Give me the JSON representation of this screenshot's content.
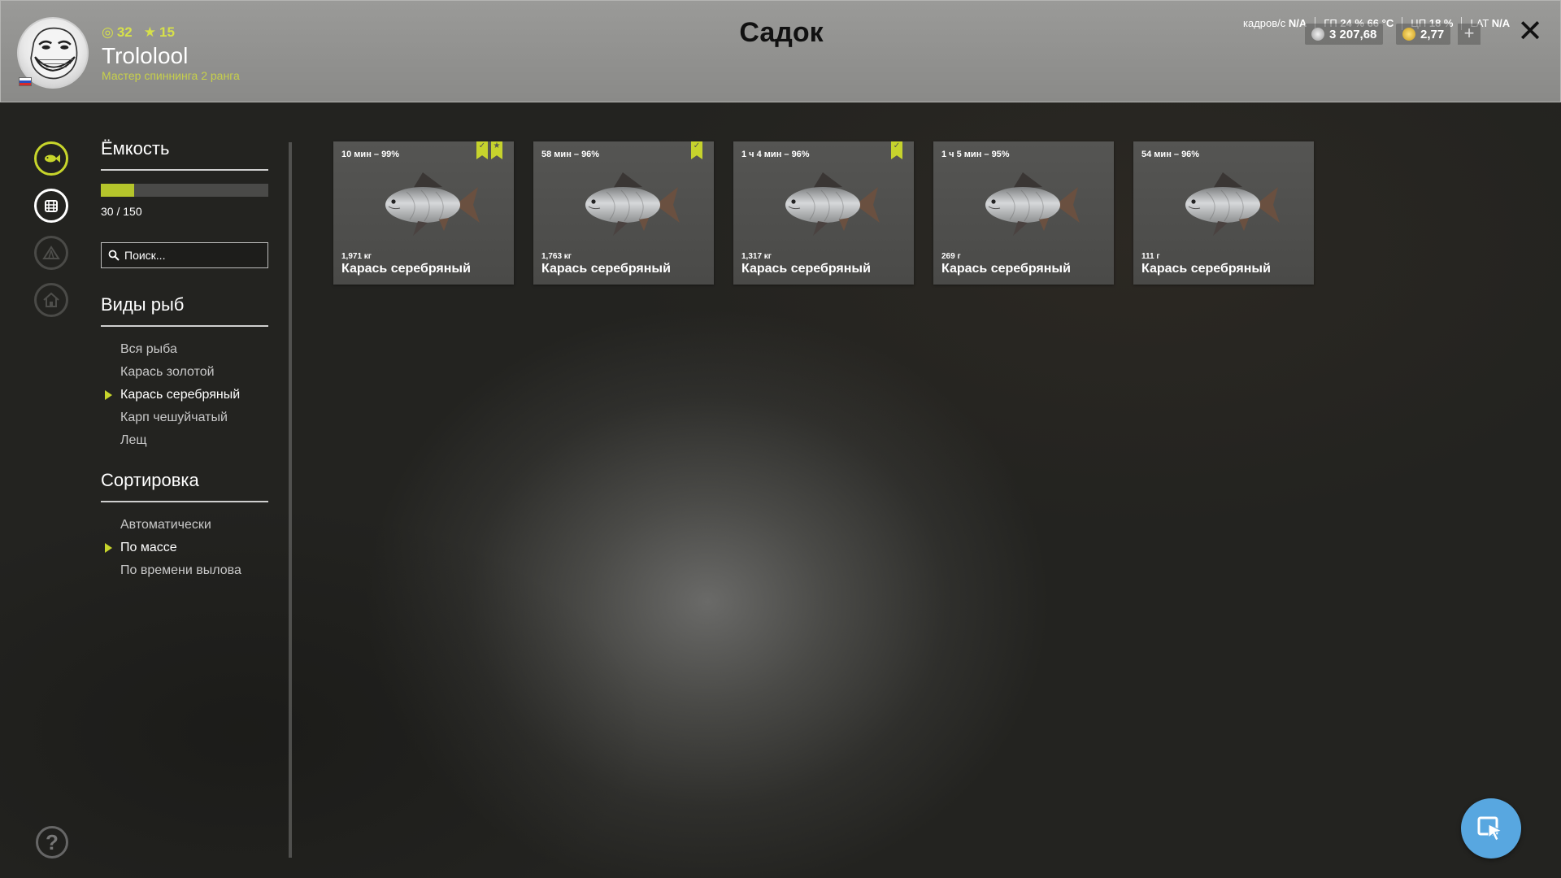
{
  "header": {
    "title": "Садок",
    "player": {
      "name": "Trololool",
      "rank": "Мастер спиннинга 2 ранга",
      "level": "32",
      "stars": "15"
    },
    "perf": {
      "fps_label": "кадров/с",
      "fps_value": "N/A",
      "gpu_label": "ГП",
      "gpu_value": "24 %",
      "temp_value": "66 °C",
      "cpu_label": "ЦП",
      "cpu_value": "18 %",
      "lat_label": "LAT",
      "lat_value": "N/A"
    },
    "silver": "3 207,68",
    "gold": "2,77",
    "plus_label": "+",
    "close_label": "✕"
  },
  "panel": {
    "capacity_title": "Ёмкость",
    "capacity_text": "30 / 150",
    "capacity_fraction": 0.2,
    "search_placeholder": "Поиск...",
    "species_title": "Виды рыб",
    "species": [
      {
        "label": "Вся рыба",
        "active": false
      },
      {
        "label": "Карась золотой",
        "active": false
      },
      {
        "label": "Карась серебряный",
        "active": true
      },
      {
        "label": "Карп чешуйчатый",
        "active": false
      },
      {
        "label": "Лещ",
        "active": false
      }
    ],
    "sort_title": "Сортировка",
    "sort": [
      {
        "label": "Автоматически",
        "active": false
      },
      {
        "label": "По массе",
        "active": true
      },
      {
        "label": "По времени вылова",
        "active": false
      }
    ]
  },
  "fish_cards": [
    {
      "time": "10 мин – 99%",
      "weight": "1,971 кг",
      "name": "Карась серебряный",
      "bookmarks": [
        "check",
        "star"
      ]
    },
    {
      "time": "58 мин – 96%",
      "weight": "1,763 кг",
      "name": "Карась серебряный",
      "bookmarks": [
        "check"
      ]
    },
    {
      "time": "1 ч 4 мин – 96%",
      "weight": "1,317 кг",
      "name": "Карась серебряный",
      "bookmarks": [
        "check"
      ]
    },
    {
      "time": "1 ч 5 мин – 95%",
      "weight": "269 г",
      "name": "Карась серебряный",
      "bookmarks": []
    },
    {
      "time": "54 мин – 96%",
      "weight": "111 г",
      "name": "Карась серебряный",
      "bookmarks": []
    }
  ],
  "help_label": "?",
  "colors": {
    "accent": "#c7d52b",
    "fab": "#58a7e0"
  }
}
